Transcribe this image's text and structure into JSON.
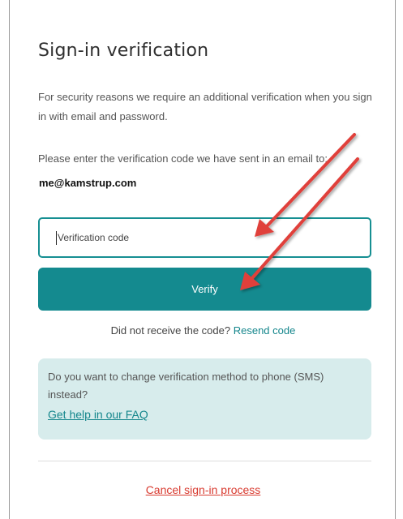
{
  "page": {
    "title": "Sign-in verification",
    "security_note": "For security reasons we require an additional verification when you sign in with email and password.",
    "instruction": "Please enter the verification code we have sent in an email to:",
    "email": "me@kamstrup.com"
  },
  "form": {
    "code_placeholder": "Verification code",
    "code_value": "",
    "verify_label": "Verify"
  },
  "resend": {
    "prompt": "Did not receive the code?",
    "link_label": "Resend code"
  },
  "help_box": {
    "text": "Do you want to change verification method to phone (SMS) instead?",
    "faq_link": "Get help in our FAQ"
  },
  "footer": {
    "cancel_label": "Cancel sign-in process"
  },
  "colors": {
    "accent": "#148a8f",
    "help_box_bg": "#d7ecec",
    "cancel_link": "#d83a2f",
    "annotation_arrow": "#e0413a"
  }
}
